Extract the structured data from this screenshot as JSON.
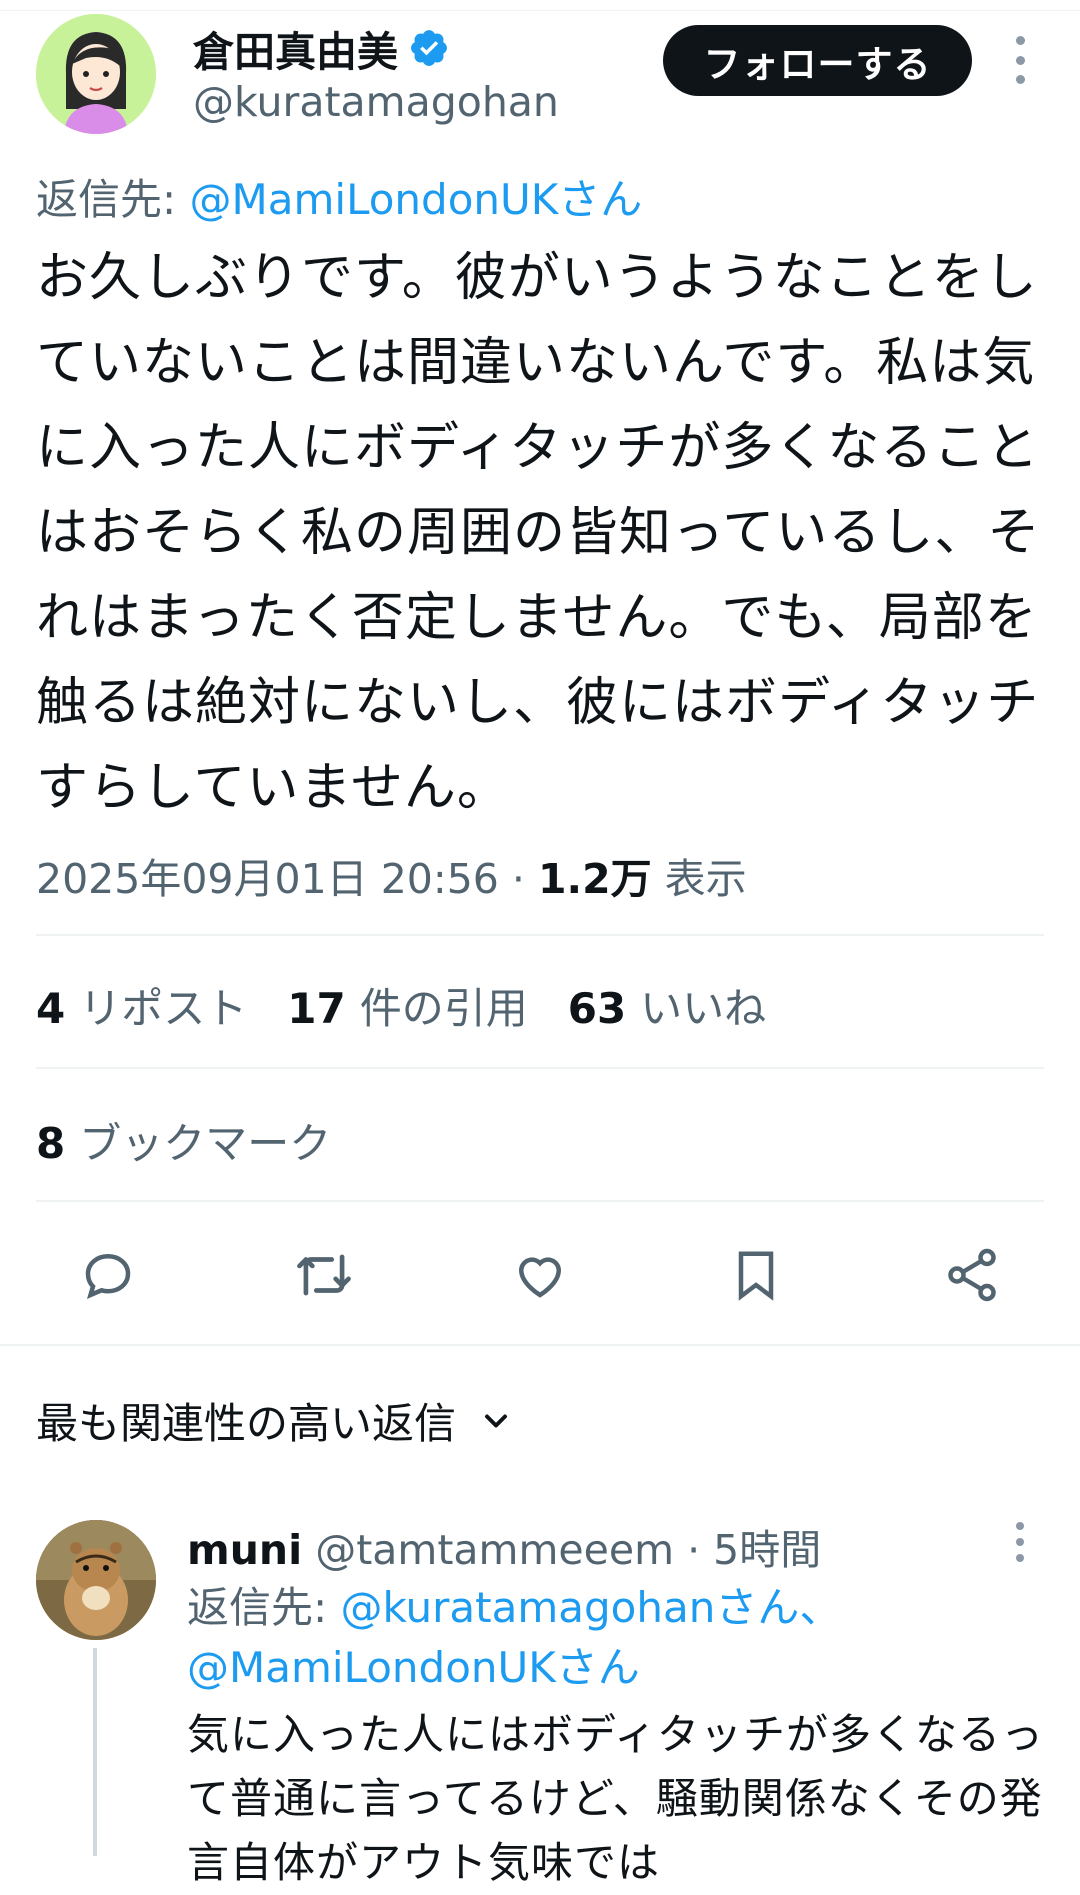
{
  "tweet": {
    "author_name": "倉田真由美",
    "author_handle": "@kuratamagohan",
    "follow_label": "フォローする",
    "reply_to_prefix": "返信先: ",
    "reply_to_mention": "@MamiLondonUKさん",
    "text": "お久しぶりです。彼がいうようなことをしていないことは間違いないんです。私は気に入った人にボディタッチが多くなることはおそらく私の周囲の皆知っているし、それはまったく否定しません。でも、局部を触るは絶対にないし、彼にはボディタッチすらしていません。",
    "timestamp": "2025年09月01日 20:56",
    "separator": " · ",
    "views_count": "1.2万",
    "views_label": " 表示"
  },
  "stats": {
    "reposts_count": "4",
    "reposts_label": "リポスト",
    "quotes_count": "17",
    "quotes_label": "件の引用",
    "likes_count": "63",
    "likes_label": "いいね",
    "bookmarks_count": "8",
    "bookmarks_label": "ブックマーク"
  },
  "actions": [
    "reply-icon",
    "repost-icon",
    "like-icon",
    "bookmark-icon",
    "share-icon"
  ],
  "replies_sort": {
    "label": "最も関連性の高い返信"
  },
  "reply": {
    "author_name": "muni",
    "author_handle": "@tamtammeeem",
    "time": " · 5時間",
    "reply_to_prefix": "返信先: ",
    "reply_to_mention_1": "@kuratamagohanさん、",
    "reply_to_mention_2": "@MamiLondonUKさん",
    "text": "気に入った人にはボディタッチが多くなるって普通に言ってるけど、騒動関係なくその発言自体がアウト気味では"
  },
  "colors": {
    "accent": "#1d9bf0",
    "text_primary": "#0f1419",
    "text_secondary": "#536471",
    "divider": "#eff3f4"
  }
}
